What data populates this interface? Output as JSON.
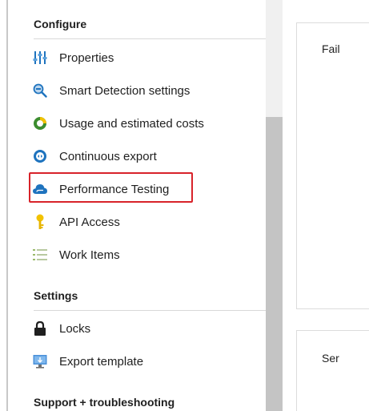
{
  "sidebar": {
    "sections": [
      {
        "header": "Configure",
        "items": [
          {
            "label": "Properties",
            "icon": "properties-icon"
          },
          {
            "label": "Smart Detection settings",
            "icon": "smart-detection-icon"
          },
          {
            "label": "Usage and estimated costs",
            "icon": "usage-costs-icon"
          },
          {
            "label": "Continuous export",
            "icon": "continuous-export-icon"
          },
          {
            "label": "Performance Testing",
            "icon": "cloud-icon"
          },
          {
            "label": "API Access",
            "icon": "key-icon"
          },
          {
            "label": "Work Items",
            "icon": "work-items-icon"
          }
        ]
      },
      {
        "header": "Settings",
        "items": [
          {
            "label": "Locks",
            "icon": "lock-icon"
          },
          {
            "label": "Export template",
            "icon": "export-template-icon"
          }
        ]
      },
      {
        "header": "Support + troubleshooting",
        "items": []
      }
    ],
    "highlighted_item": "Performance Testing",
    "highlight_color": "#d8232a"
  },
  "main": {
    "cards": [
      {
        "title": "Fail"
      },
      {
        "title": "Ser"
      }
    ]
  },
  "colors": {
    "accent_blue": "#1e73be",
    "icon_green": "#3c8d2f",
    "icon_yellow": "#f2c200"
  }
}
